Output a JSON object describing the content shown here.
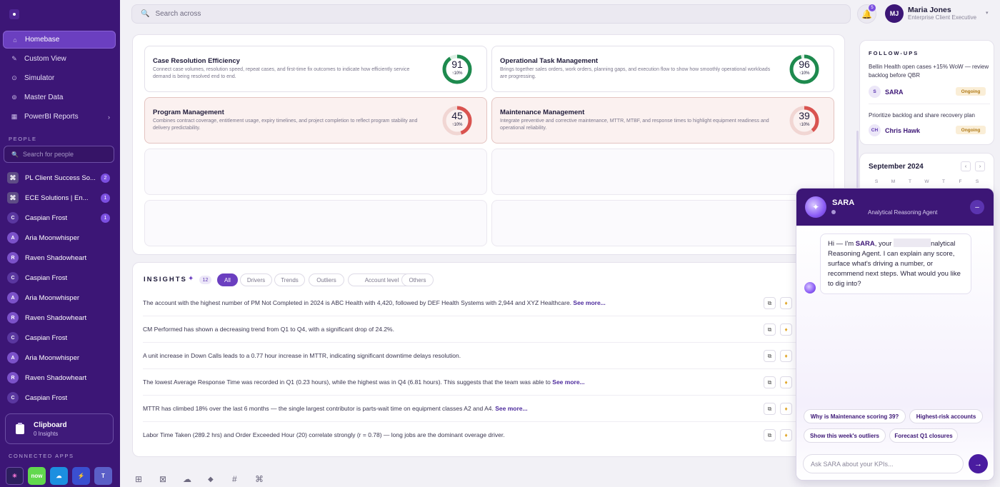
{
  "sidebar": {
    "nav": [
      {
        "label": "Homebase",
        "icon": "home-icon",
        "active": true
      },
      {
        "label": "Custom View",
        "icon": "pen-icon"
      },
      {
        "label": "Simulator",
        "icon": "simulator-icon"
      },
      {
        "label": "Master Data",
        "icon": "database-icon"
      },
      {
        "label": "PowerBI Reports",
        "icon": "report-icon"
      }
    ],
    "people_label": "PEOPLE",
    "people_search_placeholder": "Search for people",
    "people": [
      {
        "name": "PL Client Success So...",
        "initial": "⌘",
        "badge": "2"
      },
      {
        "name": "ECE Solutions | En...",
        "initial": "⌘",
        "badge": "1"
      },
      {
        "name": "Caspian Frost",
        "initial": "C",
        "badge": "1"
      },
      {
        "name": "Aria Moonwhisper",
        "initial": "A"
      },
      {
        "name": "Raven Shadowheart",
        "initial": "R"
      },
      {
        "name": "Caspian Frost",
        "initial": "C"
      },
      {
        "name": "Aria Moonwhisper",
        "initial": "A"
      },
      {
        "name": "Raven Shadowheart",
        "initial": "R"
      },
      {
        "name": "Caspian Frost",
        "initial": "C"
      },
      {
        "name": "Aria Moonwhisper",
        "initial": "A"
      },
      {
        "name": "Raven Shadowheart",
        "initial": "R"
      },
      {
        "name": "Caspian Frost",
        "initial": "C"
      }
    ],
    "clipboard": {
      "title": "Clipboard",
      "subtitle": "0 Insights"
    },
    "connected_label": "CONNECTED APPS",
    "apps": [
      {
        "label": "✳",
        "color": "#2d1f5e"
      },
      {
        "label": "now",
        "color": "#62d84e"
      },
      {
        "label": "☁",
        "color": "#1c8fe0"
      },
      {
        "label": "⚡",
        "color": "#3a4fd0"
      },
      {
        "label": "T",
        "color": "#5b5fc7"
      }
    ]
  },
  "topbar": {
    "search_placeholder": "Search across",
    "notifications": "5",
    "user_initials": "MJ",
    "user_name": "Maria Jones",
    "user_role": "Enterprise Client Executive"
  },
  "kpis": [
    {
      "title": "Case Resolution Efficiency",
      "desc": "Connect case volumes, resolution speed, repeat cases, and first-time fix outcomes to indicate how efficiently service demand is being resolved end to end.",
      "score": 91,
      "delta": "↑10%",
      "status": "good"
    },
    {
      "title": "Operational Task Management",
      "desc": "Brings together sales orders, work orders, planning gaps, and execution flow to show how smoothly operational workloads are progressing.",
      "score": 96,
      "delta": "↑10%",
      "status": "good"
    },
    {
      "title": "Program Management",
      "desc": "Combines contract coverage, entitlement usage, expiry timelines, and project completion to reflect program stability and delivery predictability.",
      "score": 45,
      "delta": "↑10%",
      "status": "bad"
    },
    {
      "title": "Maintenance Management",
      "desc": "Integrate preventive and corrective maintenance, MTTR, MTBF, and response times to highlight equipment readiness and operational reliability.",
      "score": 39,
      "delta": "↑10%",
      "status": "bad"
    }
  ],
  "colors": {
    "good": "#1e8a4e",
    "bad": "#d9534f",
    "brand": "#3c1676",
    "accent": "#6b3fc0"
  },
  "insights": {
    "title": "INSIGHTS",
    "count": "12",
    "filters": [
      "All",
      "Drivers",
      "Trends",
      "Outliers",
      "Account level",
      "Others"
    ],
    "rows": [
      {
        "text": "The account with the highest number of PM Not Completed in 2024 is ABC Health with 4,420, followed by DEF Health Systems with 2,944 and XYZ Healthcare.",
        "more": "See more..."
      },
      {
        "text": "CM Performed has shown a decreasing trend from Q1 to Q4, with a significant drop of 24.2%.",
        "more": ""
      },
      {
        "text": "A unit increase in Down Calls leads to a 0.77 hour increase in MTTR, indicating significant downtime delays resolution.",
        "more": ""
      },
      {
        "text": "The lowest Average Response Time was recorded in Q1 (0.23 hours), while the highest was in Q4 (6.81 hours). This suggests that the team was able to",
        "more": "See more..."
      },
      {
        "text": "MTTR has climbed 18% over the last 6 months — the single largest contributor is parts-wait time on equipment classes A2 and A4.",
        "more": "See more..."
      },
      {
        "text": "Labor Time Taken (289.2 hrs) and Order Exceeded Hour (20) correlate strongly (r = 0.78) — long jobs are the dominant overage driver.",
        "more": ""
      }
    ]
  },
  "followups": {
    "title": "FOLLOW-UPS",
    "items": [
      {
        "text": "Bellin Health open cases +15% WoW — review backlog before QBR",
        "initials": "S",
        "owner": "SARA",
        "status": "Ongoing"
      },
      {
        "text": "Prioritize backlog and share recovery plan",
        "initials": "CH",
        "owner": "Chris Hawk",
        "status": "Ongoing"
      }
    ]
  },
  "calendar": {
    "month": "September 2024",
    "days": [
      "S",
      "M",
      "T",
      "W",
      "T",
      "F",
      "S"
    ]
  },
  "chat": {
    "name": "SARA",
    "role": "Analytical Reasoning Agent",
    "greeting_pre": "Hi — I'm ",
    "greeting_name": "SARA",
    "greeting_mid": ", your ",
    "greeting_post": "nalytical Reasoning Agent. I can explain any score, surface what's driving a number, or recommend next steps. What would you like to dig into?",
    "suggestions": [
      "Why is Maintenance scoring 39?",
      "Highest-risk accounts",
      "Show this week's outliers",
      "Forecast Q1 closures"
    ],
    "input_placeholder": "Ask SARA about your KPIs..."
  }
}
